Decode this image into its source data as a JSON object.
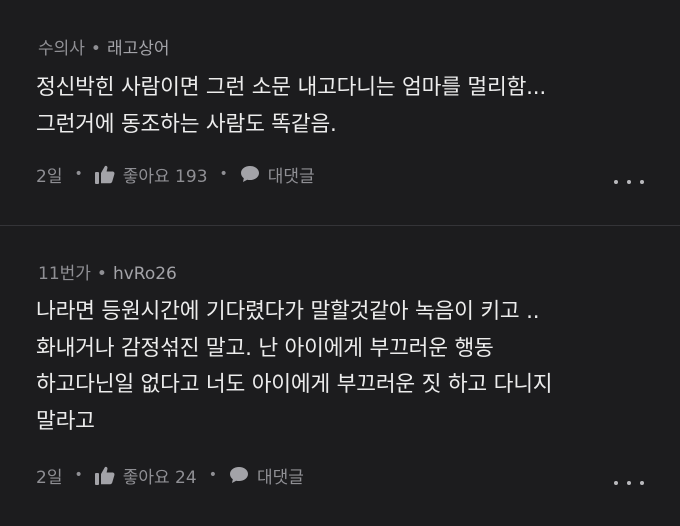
{
  "comments": [
    {
      "meta_prefix": "수의사",
      "username": "래고상어",
      "body_lines": [
        "정신박힌 사람이면 그런 소문 내고다니는 엄마를 멀리함...",
        "그런거에 동조하는 사람도 똑같음."
      ],
      "time": "2일",
      "like_label": "좋아요 193",
      "reply_label": "대댓글"
    },
    {
      "meta_prefix": "11번가",
      "username": "hvRo26",
      "body_lines": [
        "나라면 등원시간에 기다렸다가 말할것같아 녹음이 키고 ..",
        "화내거나 감정섞진 말고. 난 아이에게 부끄러운 행동",
        "하고다닌일 없다고 너도 아이에게 부끄러운 짓 하고 다니지",
        "말라고"
      ],
      "time": "2일",
      "like_label": "좋아요 24",
      "reply_label": "대댓글"
    }
  ],
  "separator": "•",
  "icons": {
    "like": "thumbs-up-icon",
    "reply": "speech-bubble-icon",
    "more": "more-dots-icon"
  },
  "colors": {
    "background": "#1c1c1e",
    "text": "#ececec",
    "muted": "#8f8f94"
  }
}
